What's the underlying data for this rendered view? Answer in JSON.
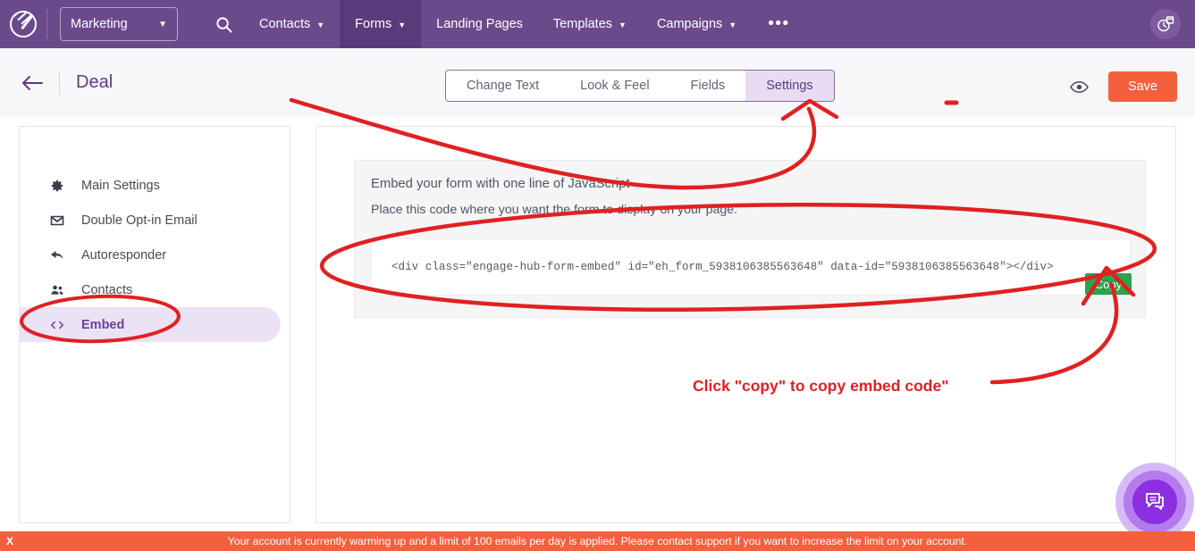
{
  "topnav": {
    "logo": "engagebay-logo",
    "workspace_label": "Marketing",
    "workspace_caret": "▼",
    "search_icon": "search-icon",
    "items": [
      {
        "label": "Contacts",
        "caret": "▼",
        "active": false
      },
      {
        "label": "Forms",
        "caret": "▼",
        "active": true
      },
      {
        "label": "Landing Pages",
        "caret": "",
        "active": false
      },
      {
        "label": "Templates",
        "caret": "▼",
        "active": false
      },
      {
        "label": "Campaigns",
        "caret": "▼",
        "active": false
      }
    ],
    "more_label": "•••",
    "avatar_icon": "clock-calendar-icon",
    "bg_color": "#6b4a8c",
    "active_bg_color": "#5b3a7c"
  },
  "subheader": {
    "back_icon": "back-arrow-icon",
    "title": "Deal",
    "tabs": [
      {
        "label": "Change Text",
        "active": false
      },
      {
        "label": "Look & Feel",
        "active": false
      },
      {
        "label": "Fields",
        "active": false
      },
      {
        "label": "Settings",
        "active": true
      }
    ],
    "preview_icon": "eye-icon",
    "save_label": "Save",
    "save_color": "#f4603e",
    "tab_active_bg": "#e8dcf2"
  },
  "sidebar": {
    "items": [
      {
        "label": "Main Settings",
        "icon": "gear-icon",
        "active": false
      },
      {
        "label": "Double Opt-in Email",
        "icon": "envelope-icon",
        "active": false
      },
      {
        "label": "Autoresponder",
        "icon": "reply-arrow-icon",
        "active": false
      },
      {
        "label": "Contacts",
        "icon": "people-icon",
        "active": false
      },
      {
        "label": "Embed",
        "icon": "code-brackets-icon",
        "active": true
      }
    ],
    "active_bg": "#ece2f5",
    "active_color": "#6b3fa0"
  },
  "embed_panel": {
    "title": "Embed your form with one line of JavaScript",
    "subtitle": "Place this code where you want the form to display on your page.",
    "code": "<div class=\"engage-hub-form-embed\" id=\"eh_form_5938106385563648\" data-id=\"5938106385563648\"></div>",
    "copy_label": "Copy",
    "copy_color": "#2aa44f"
  },
  "annotation": {
    "text": "Click \"copy\" to copy embed code\"",
    "color": "#e02121"
  },
  "chat_widget": {
    "icon": "chat-bubble-icon",
    "color": "#8b2fe0"
  },
  "banner": {
    "close_label": "X",
    "text": "Your account is currently warming up and a limit of 100 emails per day is applied. Please contact support if you want to increase the limit on your account.",
    "bg_color": "#f4603e"
  }
}
